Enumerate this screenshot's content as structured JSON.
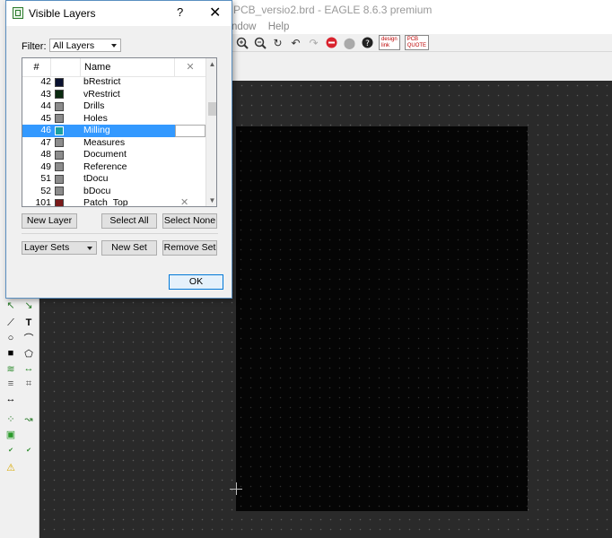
{
  "app": {
    "title": "PCB_versio2.brd - EAGLE 8.6.3 premium",
    "menu": [
      "ndow",
      "Help"
    ],
    "toolbar_badges": [
      {
        "line1": "design",
        "line2": "link"
      },
      {
        "line1": "PCB",
        "line2": "QUOTE"
      }
    ]
  },
  "dialog": {
    "title": "Visible Layers",
    "help": "?",
    "close": "✕",
    "filter_label": "Filter:",
    "filter_value": "All Layers",
    "columns": {
      "num": "#",
      "name": "Name",
      "x": "✕"
    },
    "rows": [
      {
        "num": "42",
        "name": "bRestrict",
        "color": "#0a1230",
        "selected": false
      },
      {
        "num": "43",
        "name": "vRestrict",
        "color": "#0a2a10",
        "selected": false
      },
      {
        "num": "44",
        "name": "Drills",
        "color": "#8c8c8c",
        "selected": false
      },
      {
        "num": "45",
        "name": "Holes",
        "color": "#8c8c8c",
        "selected": false
      },
      {
        "num": "46",
        "name": "Milling",
        "color": "#1aa0a0",
        "selected": true
      },
      {
        "num": "47",
        "name": "Measures",
        "color": "#8c8c8c",
        "selected": false
      },
      {
        "num": "48",
        "name": "Document",
        "color": "#8c8c8c",
        "selected": false
      },
      {
        "num": "49",
        "name": "Reference",
        "color": "#8c8c8c",
        "selected": false
      },
      {
        "num": "51",
        "name": "tDocu",
        "color": "#8c8c8c",
        "selected": false
      },
      {
        "num": "52",
        "name": "bDocu",
        "color": "#8c8c8c",
        "selected": false
      },
      {
        "num": "101",
        "name": "Patch_Top",
        "color": "#7a1a1a",
        "selected": false
      }
    ],
    "buttons": {
      "new_layer": "New Layer",
      "select_all": "Select All",
      "select_none": "Select None",
      "layer_sets": "Layer Sets",
      "new_set": "New Set",
      "remove_set": "Remove Set",
      "ok": "OK"
    }
  }
}
